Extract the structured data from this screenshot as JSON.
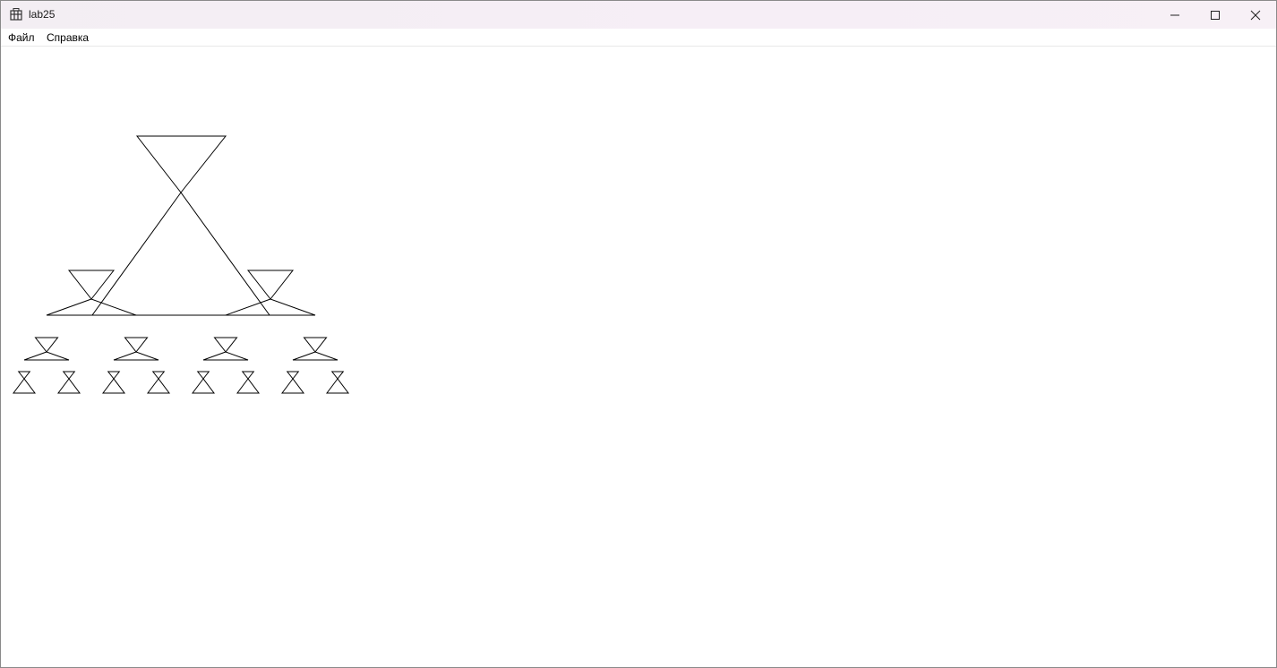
{
  "window": {
    "title": "lab25",
    "app_icon": "app-icon",
    "controls": [
      "minimize-icon",
      "maximize-icon",
      "close-icon"
    ]
  },
  "menu": {
    "items": [
      {
        "label": "Файл"
      },
      {
        "label": "Справка"
      }
    ]
  },
  "drawing": {
    "description_type": "recursive-triangle-fractal",
    "line_color": "#000000",
    "background_color": "#ffffff"
  }
}
